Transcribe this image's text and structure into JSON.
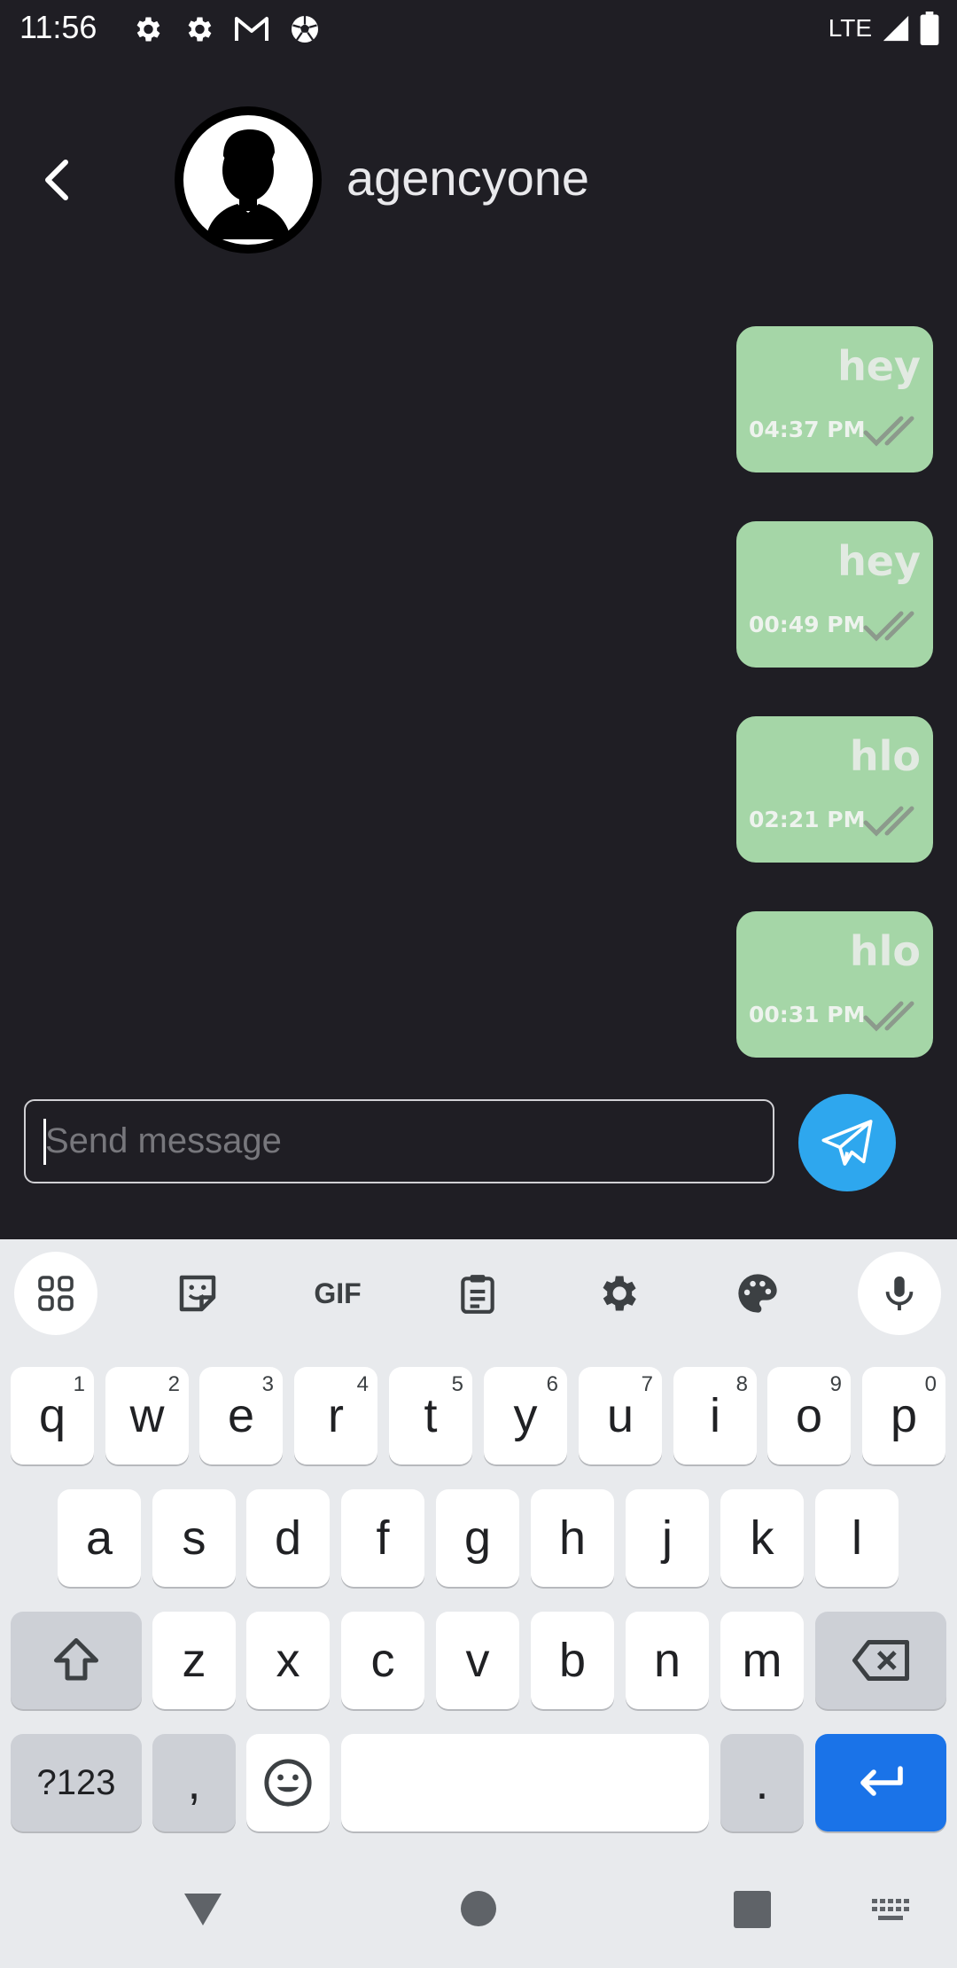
{
  "status_bar": {
    "time": "11:56",
    "network": "LTE",
    "icons": [
      "settings-icon",
      "settings-icon",
      "gmail-icon",
      "soccer-ball-icon",
      "signal-icon",
      "battery-icon"
    ]
  },
  "header": {
    "contact_name": "agencyone",
    "back_icon": "chevron-left-icon",
    "avatar_icon": "person-silhouette-icon"
  },
  "messages": [
    {
      "text": "hey",
      "time": "04:37 PM",
      "status_icon": "double-check-icon"
    },
    {
      "text": "hey",
      "time": "00:49 PM",
      "status_icon": "double-check-icon"
    },
    {
      "text": "hlo",
      "time": "02:21 PM",
      "status_icon": "double-check-icon"
    },
    {
      "text": "hlo",
      "time": "00:31 PM",
      "status_icon": "double-check-icon"
    }
  ],
  "composer": {
    "placeholder": "Send message",
    "send_icon": "paper-plane-icon"
  },
  "keyboard": {
    "toolbar": [
      "apps-grid-icon",
      "sticker-icon",
      "GIF",
      "clipboard-icon",
      "gear-icon",
      "palette-icon",
      "microphone-icon"
    ],
    "row1": [
      {
        "label": "q",
        "hint": "1"
      },
      {
        "label": "w",
        "hint": "2"
      },
      {
        "label": "e",
        "hint": "3"
      },
      {
        "label": "r",
        "hint": "4"
      },
      {
        "label": "t",
        "hint": "5"
      },
      {
        "label": "y",
        "hint": "6"
      },
      {
        "label": "u",
        "hint": "7"
      },
      {
        "label": "i",
        "hint": "8"
      },
      {
        "label": "o",
        "hint": "9"
      },
      {
        "label": "p",
        "hint": "0"
      }
    ],
    "row2": [
      "a",
      "s",
      "d",
      "f",
      "g",
      "h",
      "j",
      "k",
      "l"
    ],
    "row3": [
      "z",
      "x",
      "c",
      "v",
      "b",
      "n",
      "m"
    ],
    "symbols_label": "?123",
    "comma_label": ",",
    "period_label": "."
  },
  "colors": {
    "background": "#1f1e24",
    "bubble": "#a5d6a7",
    "send_button": "#2ea7ee",
    "enter_key": "#1a73e8"
  }
}
